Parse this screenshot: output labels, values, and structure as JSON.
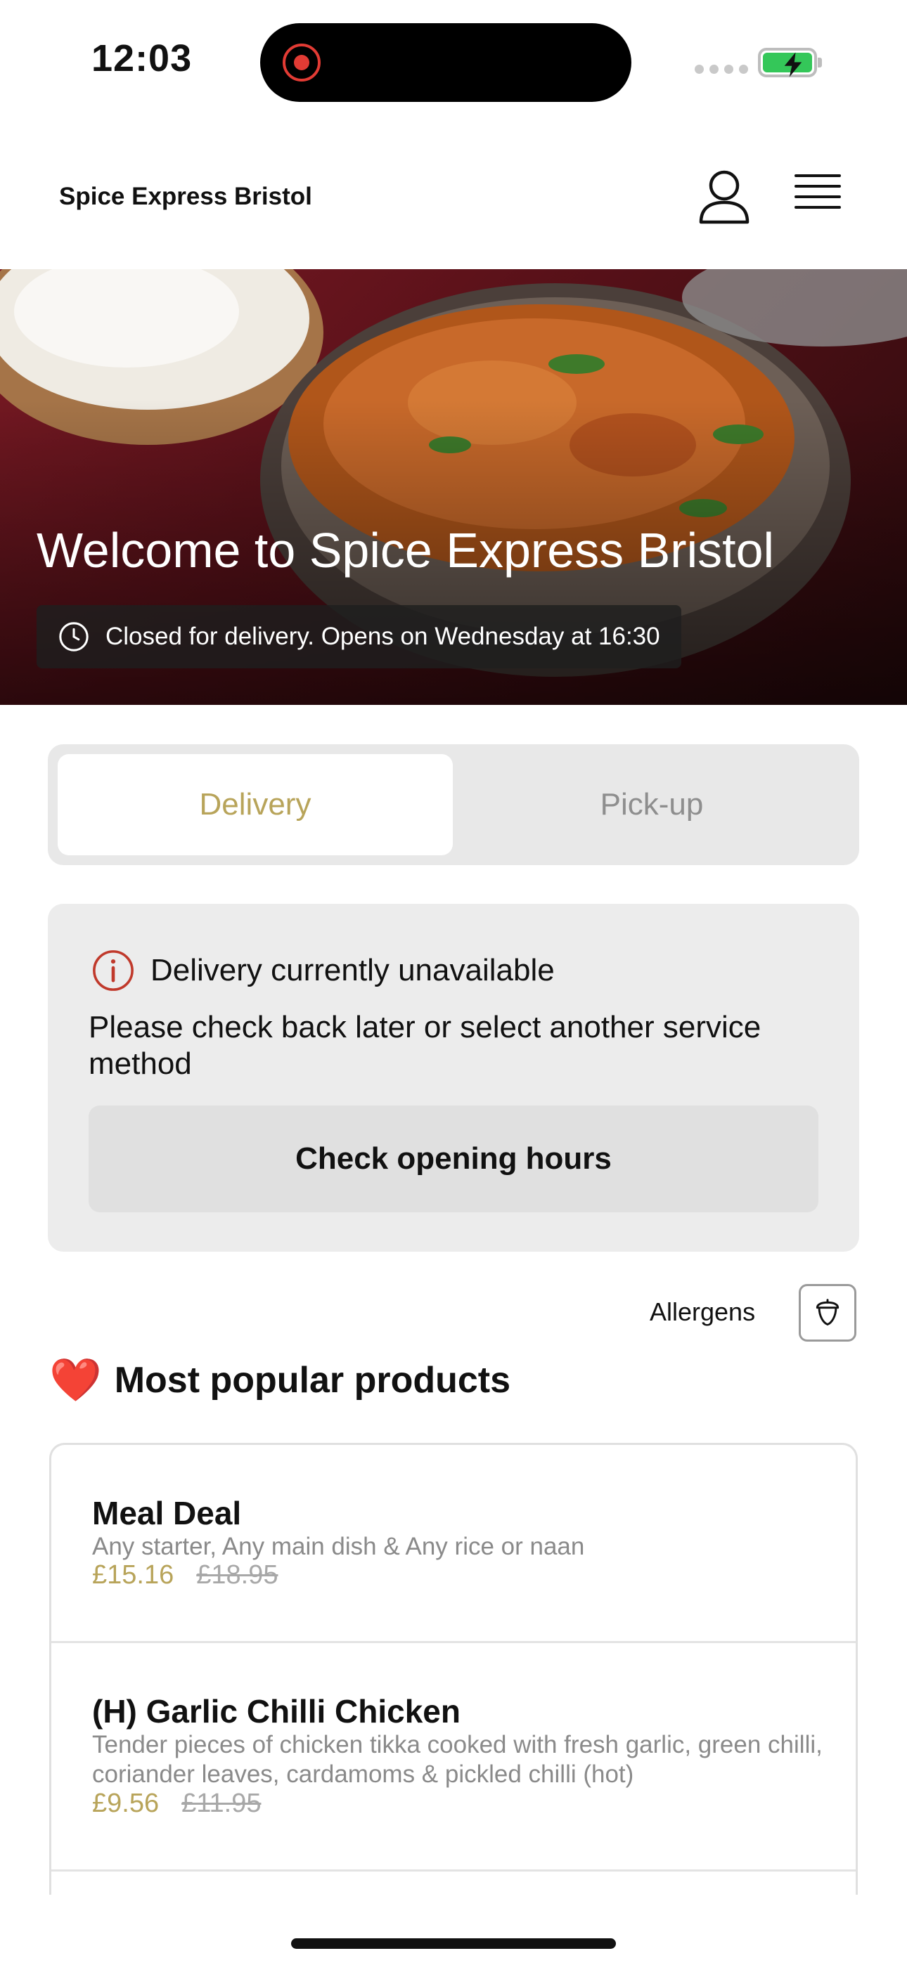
{
  "status_bar": {
    "time": "12:03",
    "battery_color": "#34c759",
    "recording_color": "#e23b34"
  },
  "header": {
    "title": "Spice Express Bristol",
    "account_icon": "user-icon",
    "menu_icon": "hamburger-menu-icon"
  },
  "hero": {
    "title": "Welcome to Spice Express Bristol",
    "status_text": "Closed for delivery. Opens on Wednesday at 16:30",
    "status_icon": "clock-icon"
  },
  "service_tabs": [
    {
      "label": "Delivery",
      "selected": true
    },
    {
      "label": "Pick-up",
      "selected": false
    }
  ],
  "notice": {
    "icon": "info-alert-icon",
    "title": "Delivery currently unavailable",
    "text": "Please check back later or select another service method",
    "button_label": "Check opening hours",
    "alert_color": "#c0392b"
  },
  "allergens": {
    "label": "Allergens",
    "icon": "acorn-icon"
  },
  "popular": {
    "emoji": "❤️",
    "title": "Most popular products",
    "products": [
      {
        "name": "Meal Deal",
        "description": "Any starter, Any main dish & Any rice or naan",
        "price": "£15.16",
        "original_price": "£18.95"
      },
      {
        "name": "(H) Garlic Chilli Chicken",
        "description": "Tender pieces of chicken tikka cooked with fresh garlic, green chilli, coriander leaves, cardamoms & pickled chilli (hot)",
        "price": "£9.56",
        "original_price": "£11.95"
      }
    ]
  },
  "accent_color": "#b8a45a"
}
